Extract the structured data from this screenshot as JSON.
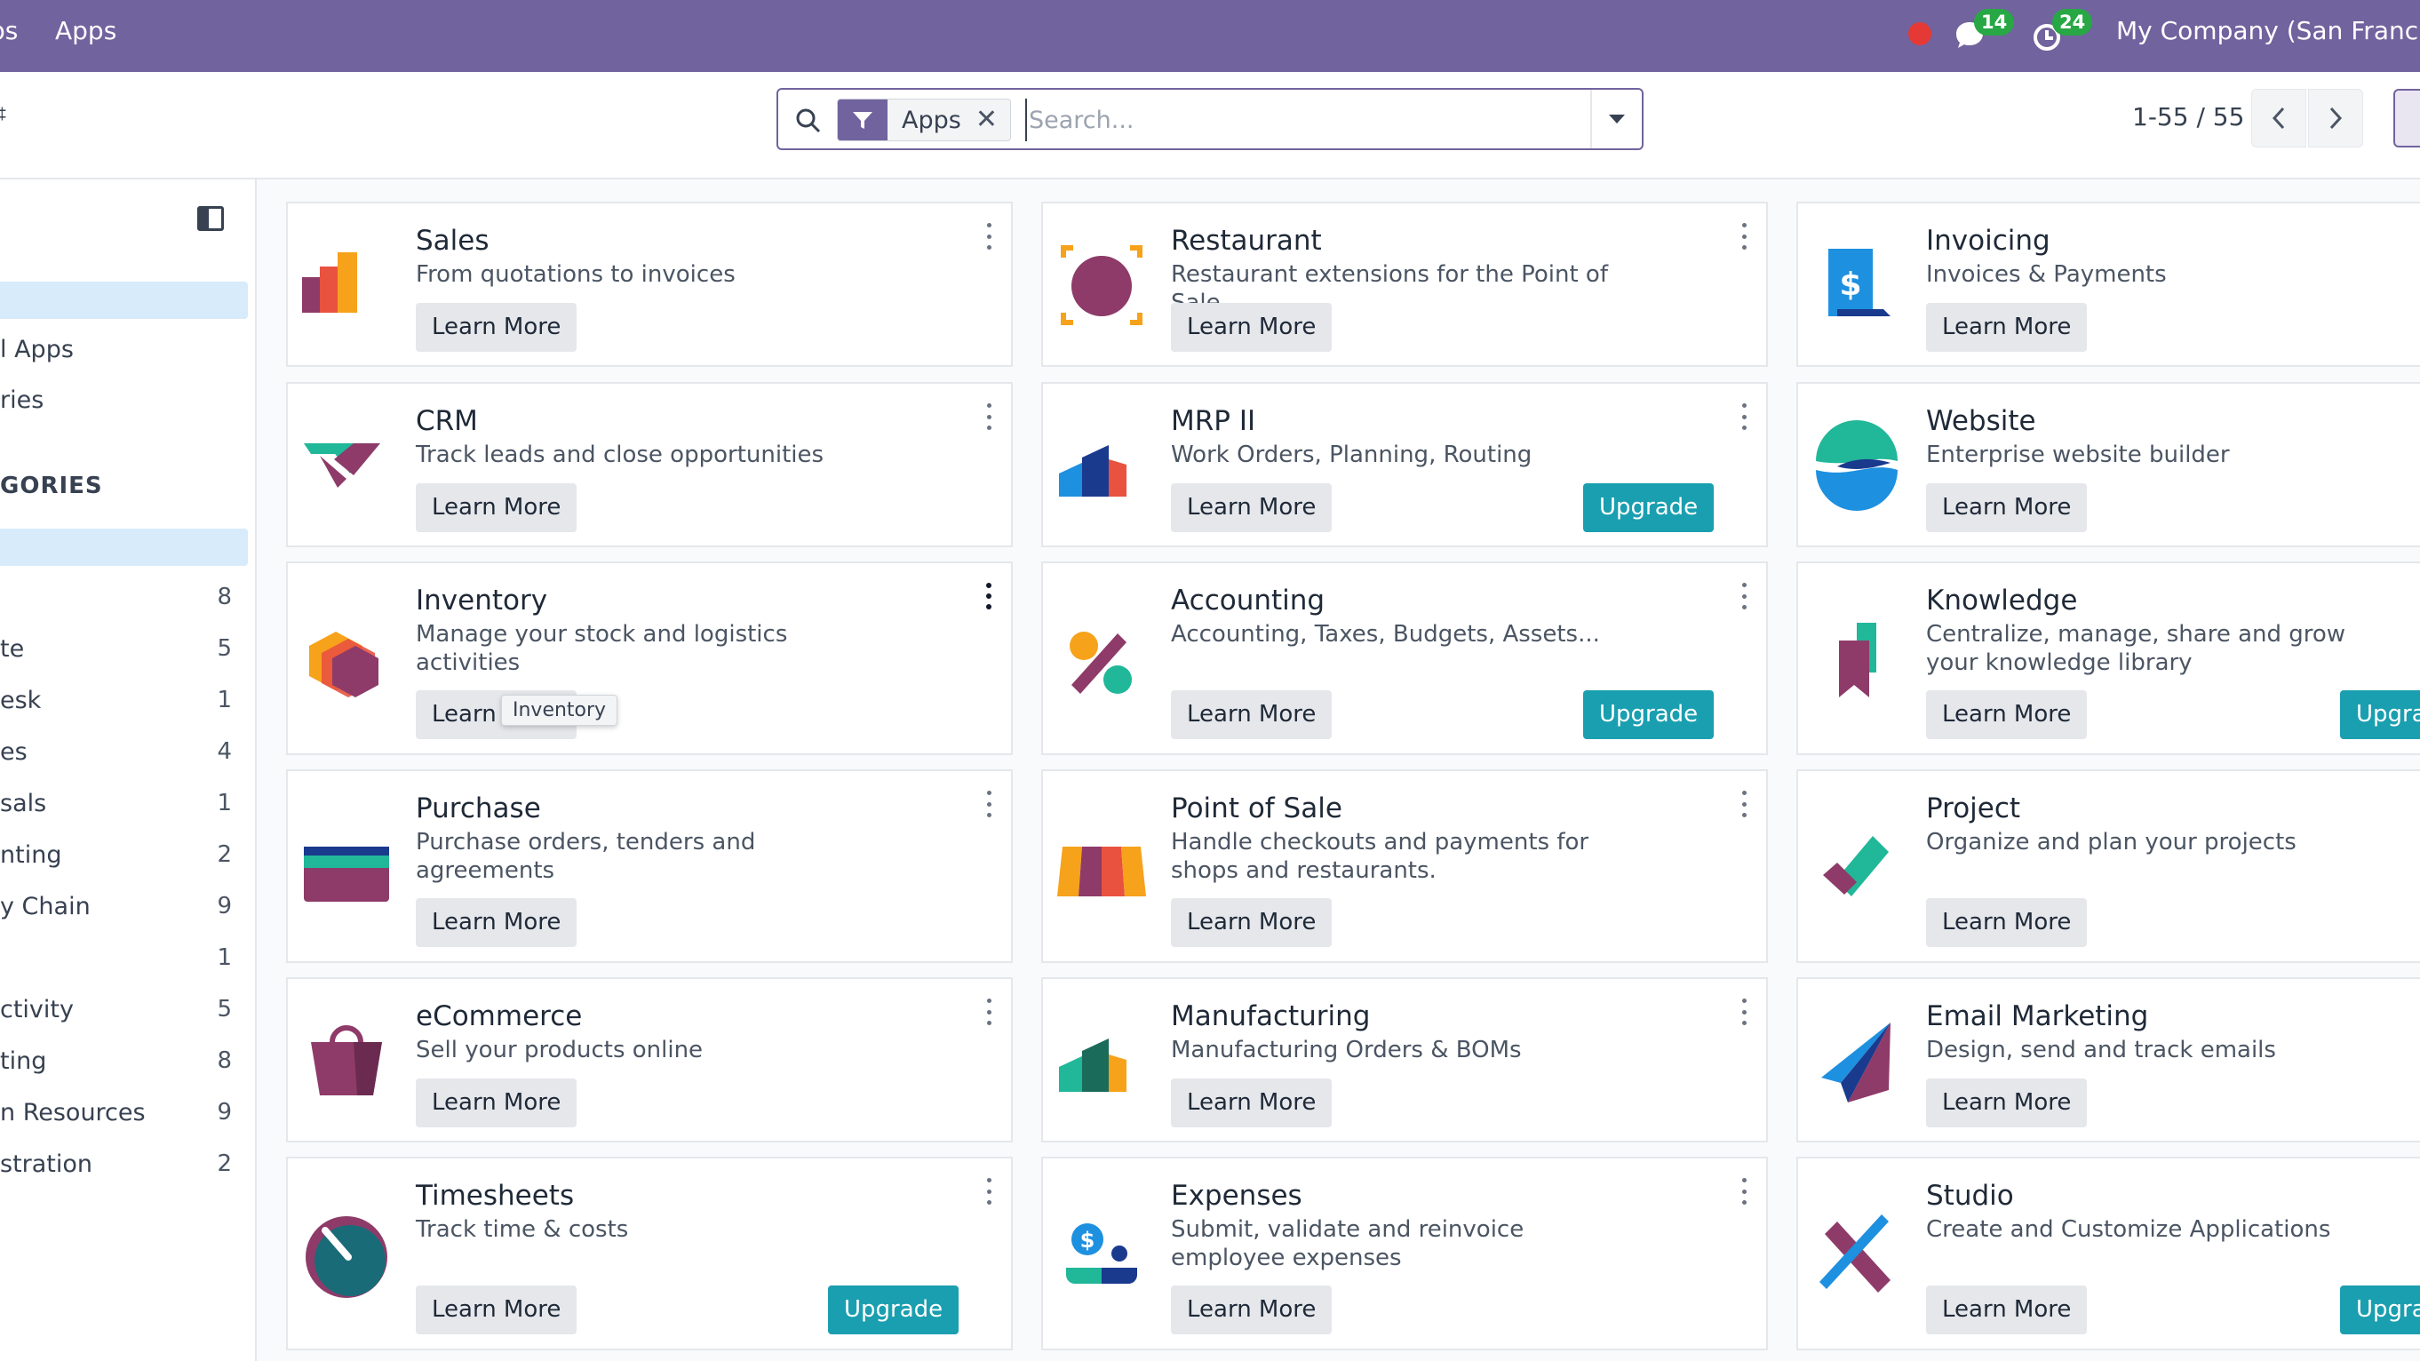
{
  "navbar": {
    "crumb_partial": "ps",
    "menu_apps": "Apps",
    "messages_count": "14",
    "activities_count": "24",
    "company": "My Company (San Francisco)"
  },
  "search": {
    "facet_label": "Apps",
    "placeholder": "Search...",
    "value": ""
  },
  "pager": {
    "value": "1-55 / 55"
  },
  "sidebar": {
    "items": [
      {
        "label": "l Apps"
      },
      {
        "label": "ries"
      }
    ],
    "categories_header": "GORIES",
    "categories": [
      {
        "label": "",
        "count": "8"
      },
      {
        "label": "te",
        "count": "5"
      },
      {
        "label": "esk",
        "count": "1"
      },
      {
        "label": "es",
        "count": "4"
      },
      {
        "label": "sals",
        "count": "1"
      },
      {
        "label": "nting",
        "count": "2"
      },
      {
        "label": "y Chain",
        "count": "9"
      },
      {
        "label": "",
        "count": "1"
      },
      {
        "label": "ctivity",
        "count": "5"
      },
      {
        "label": "ting",
        "count": "8"
      },
      {
        "label": "n Resources",
        "count": "9"
      },
      {
        "label": "stration",
        "count": "2"
      }
    ]
  },
  "cards": [
    {
      "title": "Sales",
      "description": "From quotations to invoices",
      "learn": "Learn More"
    },
    {
      "title": "Restaurant",
      "description": "Restaurant extensions for the Point of Sale",
      "learn": "Learn More"
    },
    {
      "title": "Invoicing",
      "description": "Invoices & Payments",
      "learn": "Learn More"
    },
    {
      "title": "CRM",
      "description": "Track leads and close opportunities",
      "learn": "Learn More"
    },
    {
      "title": "MRP II",
      "description": "Work Orders, Planning, Routing",
      "learn": "Learn More",
      "upgrade": "Upgrade"
    },
    {
      "title": "Website",
      "description": "Enterprise website builder",
      "learn": "Learn More"
    },
    {
      "title": "Inventory",
      "description": "Manage your stock and logistics activities",
      "learn": "Learn More",
      "tooltip": "Inventory"
    },
    {
      "title": "Accounting",
      "description": "Accounting, Taxes, Budgets, Assets...",
      "learn": "Learn More",
      "upgrade": "Upgrade"
    },
    {
      "title": "Knowledge",
      "description": "Centralize, manage, share and grow your knowledge library",
      "learn": "Learn More",
      "upgrade": "Upgrade"
    },
    {
      "title": "Purchase",
      "description": "Purchase orders, tenders and agreements",
      "learn": "Learn More"
    },
    {
      "title": "Point of Sale",
      "description": "Handle checkouts and payments for shops and restaurants.",
      "learn": "Learn More"
    },
    {
      "title": "Project",
      "description": "Organize and plan your projects",
      "learn": "Learn More"
    },
    {
      "title": "eCommerce",
      "description": "Sell your products online",
      "learn": "Learn More"
    },
    {
      "title": "Manufacturing",
      "description": "Manufacturing Orders & BOMs",
      "learn": "Learn More"
    },
    {
      "title": "Email Marketing",
      "description": "Design, send and track emails",
      "learn": "Learn More"
    },
    {
      "title": "Timesheets",
      "description": "Track time & costs",
      "learn": "Learn More",
      "upgrade": "Upgrade"
    },
    {
      "title": "Expenses",
      "description": "Submit, validate and reinvoice employee expenses",
      "learn": "Learn More"
    },
    {
      "title": "Studio",
      "description": "Create and Customize Applications",
      "learn": "Learn More",
      "upgrade": "Upgrade"
    }
  ],
  "colors": {
    "brand": "#71639e",
    "upgrade": "#1a9fb0",
    "selected": "#d7ebfa"
  }
}
